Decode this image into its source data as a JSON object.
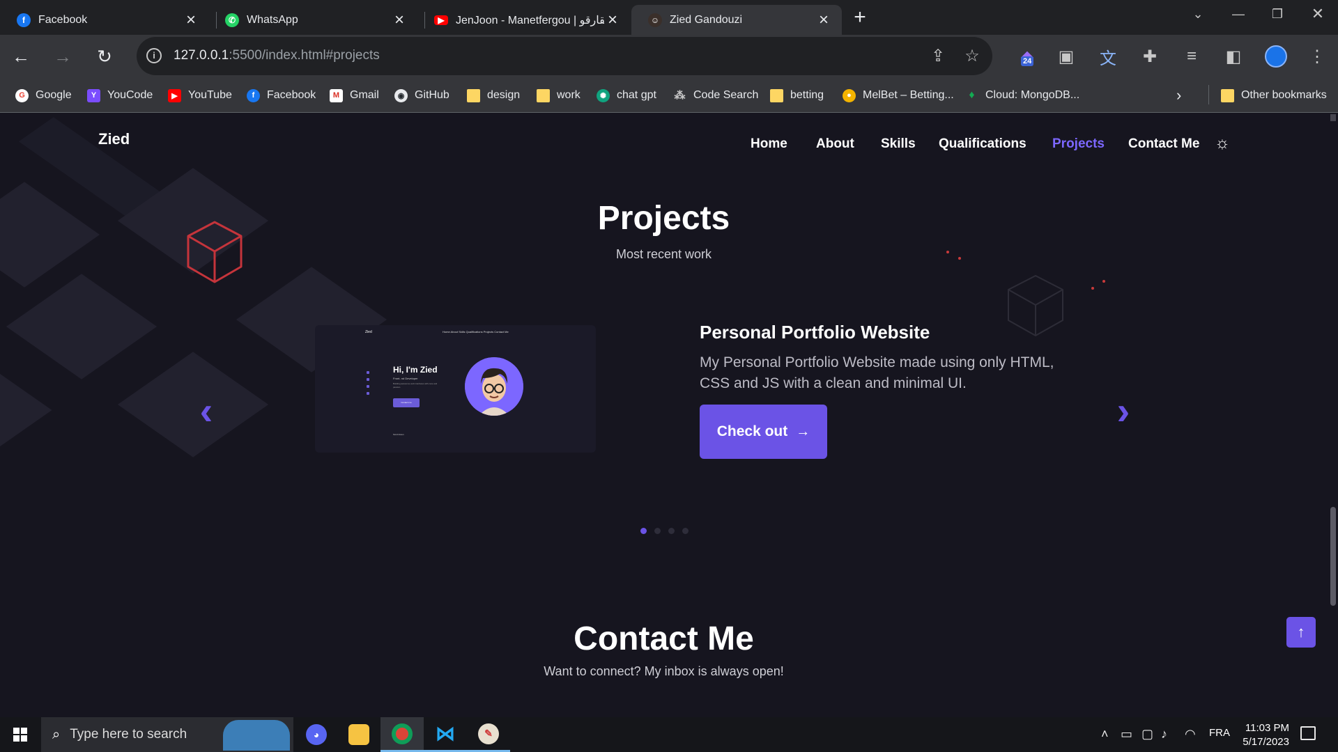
{
  "tabs": [
    {
      "title": "Facebook",
      "icon": "facebook-icon",
      "color": "#1877f2"
    },
    {
      "title": "WhatsApp",
      "icon": "whatsapp-icon",
      "color": "#25d366"
    },
    {
      "title": "JenJoon - Manetfergou | عقارقو",
      "icon": "youtube-icon",
      "color": "#ff0000"
    },
    {
      "title": "Zied Gandouzi",
      "icon": "avatar-icon",
      "color": "#3a2f2a"
    }
  ],
  "address_bar": {
    "host": "127.0.0.1",
    "path": ":5500/index.html#projects"
  },
  "bookmarks": [
    {
      "label": "Google",
      "icon": "google-icon",
      "color": "#ea4335"
    },
    {
      "label": "YouCode",
      "icon": "youcode-icon",
      "color": "#7b4dff"
    },
    {
      "label": "YouTube",
      "icon": "youtube-icon",
      "color": "#ff0000"
    },
    {
      "label": "Facebook",
      "icon": "facebook-icon",
      "color": "#1877f2"
    },
    {
      "label": "Gmail",
      "icon": "gmail-icon",
      "color": "#d93025"
    },
    {
      "label": "GitHub",
      "icon": "github-icon",
      "color": "#24292e"
    },
    {
      "label": "design",
      "icon": "folder-icon",
      "color": "#fdd663"
    },
    {
      "label": "work",
      "icon": "folder-icon",
      "color": "#fdd663"
    },
    {
      "label": "chat gpt",
      "icon": "chatgpt-icon",
      "color": "#10a37f"
    },
    {
      "label": "Code Search",
      "icon": "code-search-icon",
      "color": "#5f6368"
    },
    {
      "label": "betting",
      "icon": "folder-icon",
      "color": "#fdd663"
    },
    {
      "label": "MelBet – Betting...",
      "icon": "melbet-icon",
      "color": "#f4b400"
    },
    {
      "label": "Cloud: MongoDB...",
      "icon": "mongodb-icon",
      "color": "#13aa52"
    }
  ],
  "other_bookmarks": "Other bookmarks",
  "extension_badge": "24",
  "site": {
    "logo": "Zied",
    "nav": [
      "Home",
      "About",
      "Skills",
      "Qualifications",
      "Projects",
      "Contact Me"
    ],
    "active_nav": "Projects",
    "accent": "#6b53e6"
  },
  "projects": {
    "title": "Projects",
    "subtitle": "Most recent work",
    "current": {
      "title": "Personal Portfolio Website",
      "description": "My Personal Portfolio Website made using only HTML, CSS and JS with a clean and minimal UI.",
      "button": "Check out",
      "thumb": {
        "logo": "Zied",
        "links": "Home   About   Skills   Qualifications   Projects   Contact Me",
        "greeting": "Hi, I'm Zied",
        "role": "Front- nd Developer",
        "text": "Building awesome web interfaces with care and passion.",
        "button": "Contact me",
        "scroll": "Scroll down"
      }
    },
    "slide_count": 4,
    "active_slide": 1
  },
  "contact": {
    "title": "Contact Me",
    "subtitle": "Want to connect? My inbox is always open!"
  },
  "taskbar": {
    "search_placeholder": "Type here to search",
    "language": "FRA",
    "time": "11:03 PM",
    "date": "5/17/2023",
    "apps": [
      "discord-icon",
      "file-explorer-icon",
      "chrome-icon",
      "vscode-icon",
      "paint-icon"
    ]
  }
}
